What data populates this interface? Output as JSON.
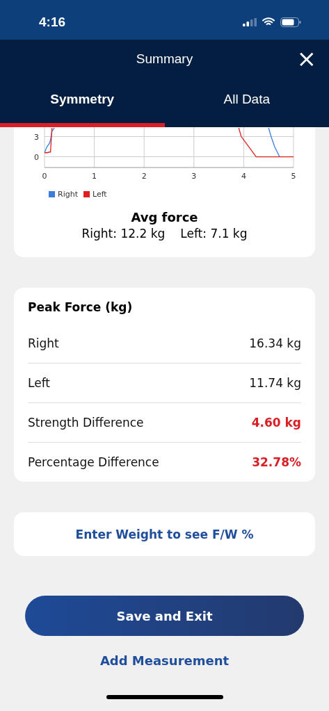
{
  "status_bar": {
    "time": "4:16"
  },
  "header": {
    "title": "Summary",
    "close": "×"
  },
  "tabs": [
    {
      "label": "Symmetry",
      "selected": true
    },
    {
      "label": "All Data",
      "selected": false
    }
  ],
  "chart": {
    "chart_data": {
      "type": "line",
      "x": [
        0,
        0.05,
        0.1,
        0.12,
        0.15,
        0.2,
        3.9,
        3.95,
        4.05,
        4.15,
        4.25,
        4.5,
        4.55,
        4.62,
        4.72,
        5
      ],
      "xticks": [
        0,
        1,
        2,
        3,
        4,
        5
      ],
      "yticks": [
        0,
        3
      ],
      "xlim": [
        0,
        5
      ],
      "ylim": [
        -1.6,
        4.4
      ],
      "grid": true,
      "series": [
        {
          "name": "Right",
          "color": "#3b7dd8",
          "values": [
            0.6,
            1.5,
            2,
            2.5,
            3.8,
            4.3,
            null,
            null,
            null,
            null,
            null,
            4.3,
            3,
            1.5,
            0,
            null
          ]
        },
        {
          "name": "Left",
          "color": "#e0201f",
          "values": [
            0.6,
            0.6,
            0.7,
            0.7,
            4.3,
            null,
            4.3,
            3,
            2,
            1,
            0,
            0,
            0,
            0,
            0,
            0
          ]
        }
      ]
    },
    "title": "Avg force",
    "right": "Right: 12.2 kg",
    "left": "Left: 7.1 kg"
  },
  "peak": {
    "title": "Peak Force (kg)",
    "rows": [
      {
        "label": "Right",
        "value": "16.34 kg",
        "highlight": false
      },
      {
        "label": "Left",
        "value": "11.74 kg",
        "highlight": false
      },
      {
        "label": "Strength Difference",
        "value": "4.60 kg",
        "highlight": true
      },
      {
        "label": "Percentage Difference",
        "value": "32.78%",
        "highlight": true
      }
    ]
  },
  "weight_link": "Enter Weight to see F/W %",
  "save_button": "Save and Exit",
  "add_link": "Add Measurement"
}
